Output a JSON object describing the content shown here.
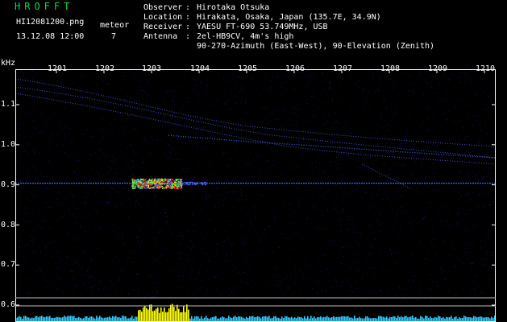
{
  "header": {
    "app_title": "HROFFT",
    "file_name": "HI12081200.png",
    "date_time": "13.12.08 12:00",
    "meteor_label": "meteor",
    "meteor_count": "7"
  },
  "info": [
    {
      "key": "Observer",
      "sep": ":",
      "value": "Hirotaka Otsuka"
    },
    {
      "key": "Location",
      "sep": ":",
      "value": "Hirakata, Osaka, Japan (135.7E, 34.9N)"
    },
    {
      "key": "Receiver",
      "sep": ":",
      "value": "YAESU FT-690 53.749MHz, USB"
    },
    {
      "key": "Antenna",
      "sep": ":",
      "value": "2el-HB9CV, 4m's high"
    },
    {
      "key": "",
      "sep": "",
      "value": "90-270-Azimuth (East-West), 90-Elevation (Zenith)"
    }
  ],
  "axes": {
    "y_unit": "kHz",
    "x_ticks": [
      "1201",
      "1202",
      "1203",
      "1204",
      "1205",
      "1206",
      "1207",
      "1208",
      "1209",
      "1210"
    ],
    "y_ticks": [
      "1.1",
      "1.0",
      "0.9",
      "0.8",
      "0.7",
      "0.6"
    ],
    "y_tick_values": [
      1.1,
      1.0,
      0.9,
      0.8,
      0.7,
      0.6
    ]
  },
  "colors": {
    "background": "#000000",
    "title": "#00dd44",
    "text": "#ffffff",
    "noise": "#1a1a8c",
    "signal_trace": "#4a6cff",
    "carrier": "#3f6bff",
    "meteor_hot": "#ff2a00",
    "meteor_warm": "#ffee00",
    "meteor_cool": "#22ff66",
    "count_bar": "#33ccff",
    "count_bar_peak": "#ffff00",
    "frame": "#ffffff"
  }
}
